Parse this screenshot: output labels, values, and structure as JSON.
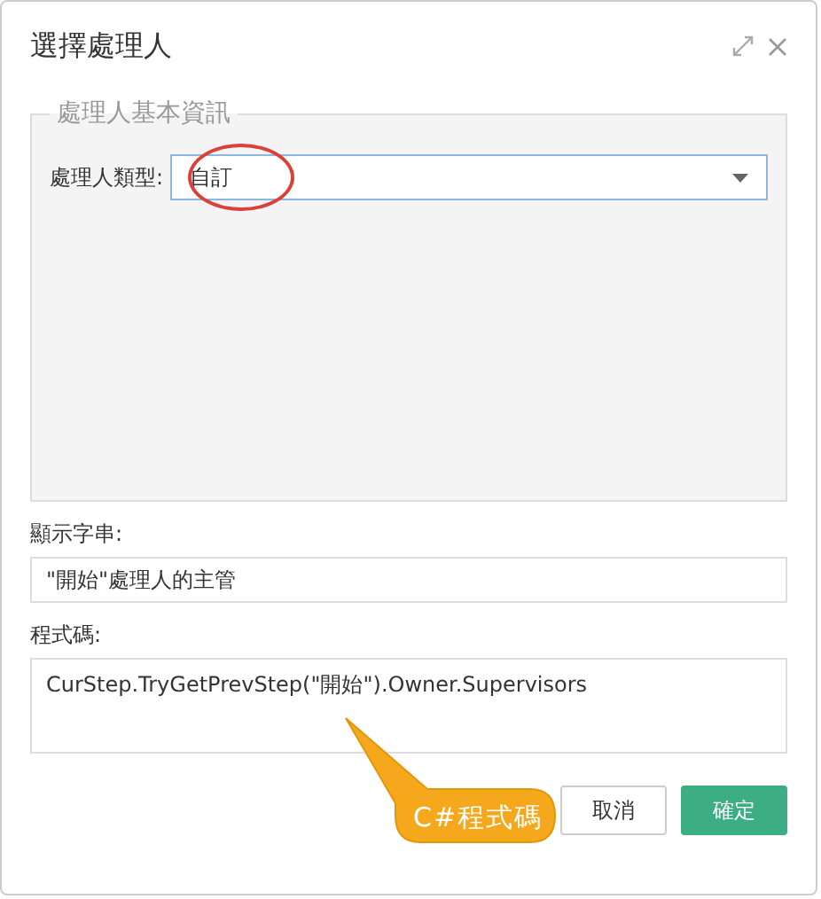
{
  "window": {
    "title": "選擇處理人"
  },
  "fieldset": {
    "legend": "處理人基本資訊",
    "type_label": "處理人類型:",
    "type_value": "自訂"
  },
  "display_string": {
    "label": "顯示字串:",
    "value": "\"開始\"處理人的主管"
  },
  "code": {
    "label": "程式碼:",
    "value": "CurStep.TryGetPrevStep(\"開始\").Owner.Supervisors"
  },
  "callout": {
    "text": "C#程式碼"
  },
  "buttons": [
    {
      "label": "取消",
      "kind": "secondary"
    },
    {
      "label": "確定",
      "kind": "primary"
    }
  ]
}
